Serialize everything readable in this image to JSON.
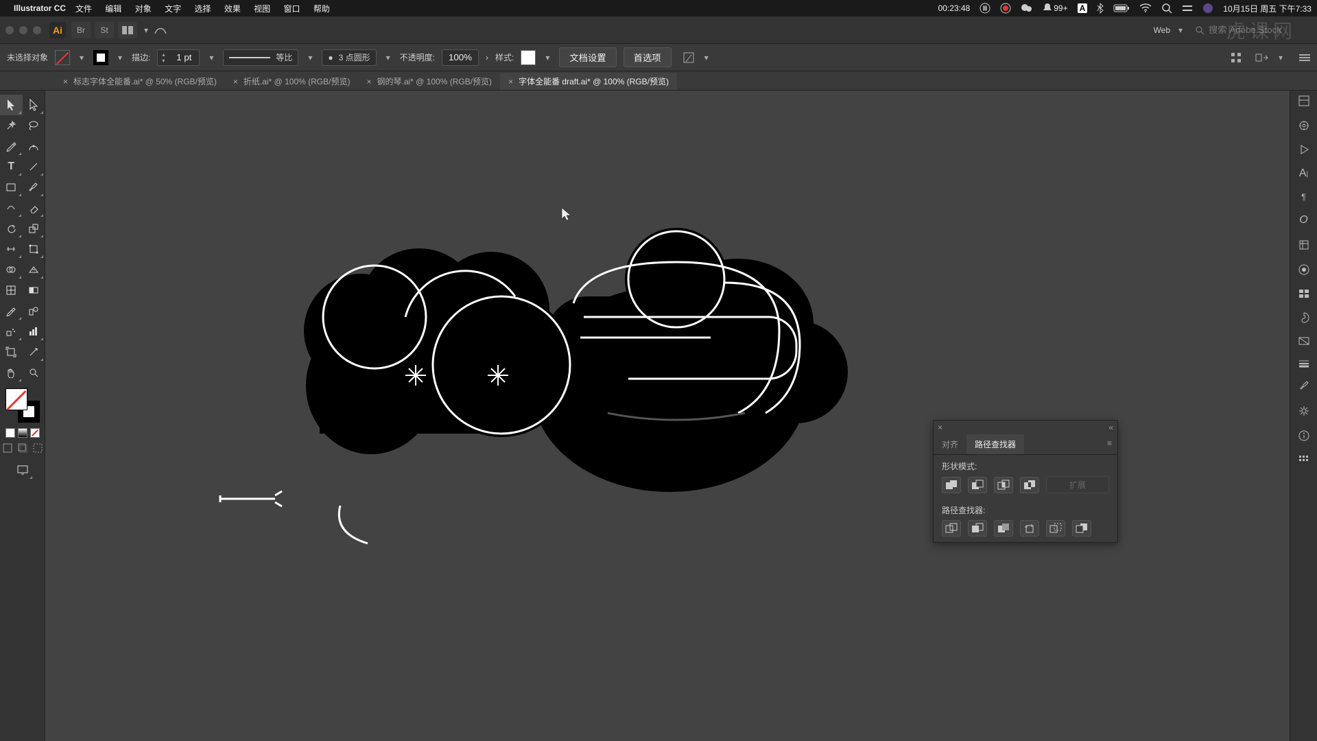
{
  "menubar": {
    "app": "Illustrator CC",
    "items": [
      "文件",
      "编辑",
      "对象",
      "文字",
      "选择",
      "效果",
      "视图",
      "窗口",
      "帮助"
    ],
    "timer": "00:23:48",
    "notif": "99+",
    "date": "10月15日 周五 下午7:33"
  },
  "apptop": {
    "doc_profile": "Web",
    "search_placeholder": "搜索 Adobe Stock"
  },
  "control": {
    "selection": "未选择对象",
    "stroke_label": "描边:",
    "stroke_weight": "1 pt",
    "stroke_profile": "等比",
    "stroke_corner": "3 点圆形",
    "opacity_label": "不透明度:",
    "opacity_value": "100%",
    "style_label": "样式:",
    "doc_setup": "文档设置",
    "prefs": "首选项"
  },
  "tabs": [
    {
      "label": "标志字体全能番.ai* @ 50% (RGB/预览)",
      "active": false
    },
    {
      "label": "折纸.ai* @ 100% (RGB/预览)",
      "active": false
    },
    {
      "label": "钢的琴.ai* @ 100% (RGB/预览)",
      "active": false
    },
    {
      "label": "字体全能番 draft.ai* @ 100% (RGB/预览)",
      "active": true
    }
  ],
  "pathfinder": {
    "tab_align": "对齐",
    "tab_pathfinder": "路径查找器",
    "shape_modes_label": "形状模式:",
    "pathfinders_label": "路径查找器:",
    "expand": "扩展"
  },
  "watermark": "虎课网"
}
